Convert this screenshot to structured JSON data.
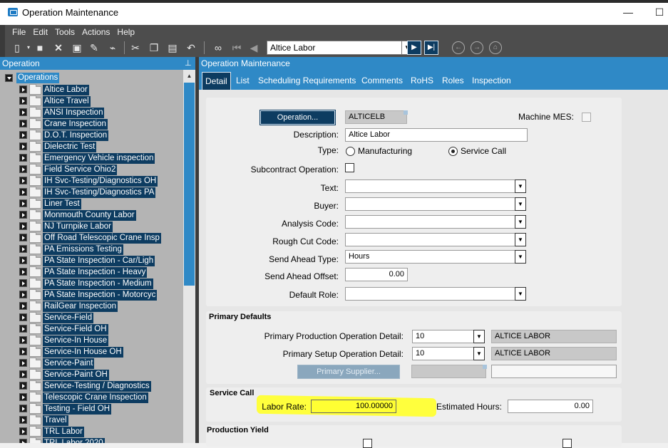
{
  "window": {
    "title": "Operation Maintenance",
    "minimize_glyph": "—",
    "maximize_glyph": "☐"
  },
  "menu": [
    "File",
    "Edit",
    "Tools",
    "Actions",
    "Help"
  ],
  "toolbar": {
    "record_value": "Altice Labor",
    "icons": [
      "new-icon",
      "save-icon",
      "delete-icon",
      "attach-icon",
      "clear-icon",
      "cut-icon",
      "copy-icon",
      "paste-icon",
      "undo-icon",
      "search-icon",
      "first-record-icon",
      "previous-record-icon",
      "next-record-icon",
      "last-record-icon",
      "back-icon",
      "forward-icon",
      "home-icon"
    ]
  },
  "left_panel": {
    "title": "Operation",
    "root_label": "Operations",
    "items": [
      "Altice Labor",
      "Altice Travel",
      "ANSI Inspection",
      "Crane Inspection",
      "D.O.T. Inspection",
      "Dielectric Test",
      "Emergency Vehicle inspection",
      "Field Service Ohio2",
      "IH Svc-Testing/Diagnostics OH",
      "IH Svc-Testing/Diagnostics PA",
      "Liner Test",
      "Monmouth County Labor",
      "NJ Turnpike Labor",
      "Off Road Telescopic Crane Insp",
      "PA Emissions Testing",
      "PA State Inspection - Car/Ligh",
      "PA State Inspection - Heavy",
      "PA State Inspection - Medium",
      "PA State Inspection - Motorcyc",
      "RailGear Inspection",
      "Service-Field",
      "Service-Field OH",
      "Service-In House",
      "Service-In House OH",
      "Service-Paint",
      "Service-Paint OH",
      "Service-Testing / Diagnostics",
      "Telescopic Crane Inspection",
      "Testing - Field OH",
      "Travel",
      "TRL Labor",
      "TRL Labor 2020"
    ]
  },
  "right_panel": {
    "title": "Operation Maintenance",
    "tabs": [
      "Detail",
      "List",
      "Scheduling Requirements",
      "Comments",
      "RoHS",
      "Roles",
      "Inspection"
    ],
    "active_tab": "Detail"
  },
  "detail": {
    "operation_button": "Operation...",
    "operation_value": "ALTICELB",
    "machine_mes_label": "Machine MES:",
    "description_label": "Description:",
    "description_value": "Altice Labor",
    "type_label": "Type:",
    "type_manufacturing": "Manufacturing",
    "type_service_call": "Service Call",
    "type_selected": "Service Call",
    "subcontract_label": "Subcontract Operation:",
    "text_label": "Text:",
    "text_value": "",
    "buyer_label": "Buyer:",
    "buyer_value": "",
    "analysis_code_label": "Analysis Code:",
    "analysis_code_value": "",
    "rough_cut_code_label": "Rough Cut Code:",
    "rough_cut_code_value": "",
    "send_ahead_type_label": "Send Ahead Type:",
    "send_ahead_type_value": "Hours",
    "send_ahead_offset_label": "Send Ahead Offset:",
    "send_ahead_offset_value": "0.00",
    "default_role_label": "Default Role:",
    "default_role_value": ""
  },
  "primary_defaults": {
    "title": "Primary Defaults",
    "production_label": "Primary Production Operation Detail:",
    "production_value": "10",
    "production_desc": "ALTICE LABOR",
    "setup_label": "Primary Setup Operation Detail:",
    "setup_value": "10",
    "setup_desc": "ALTICE LABOR",
    "supplier_button": "Primary Supplier..."
  },
  "service_call": {
    "title": "Service Call",
    "labor_rate_label": "Labor Rate:",
    "labor_rate_value": "100.00000",
    "estimated_hours_label": "Estimated Hours:",
    "estimated_hours_value": "0.00"
  },
  "production_yield": {
    "title": "Production Yield"
  },
  "colors": {
    "accent": "#2f89c6",
    "dark_navy": "#0d3c61",
    "highlight": "#ffff33"
  }
}
